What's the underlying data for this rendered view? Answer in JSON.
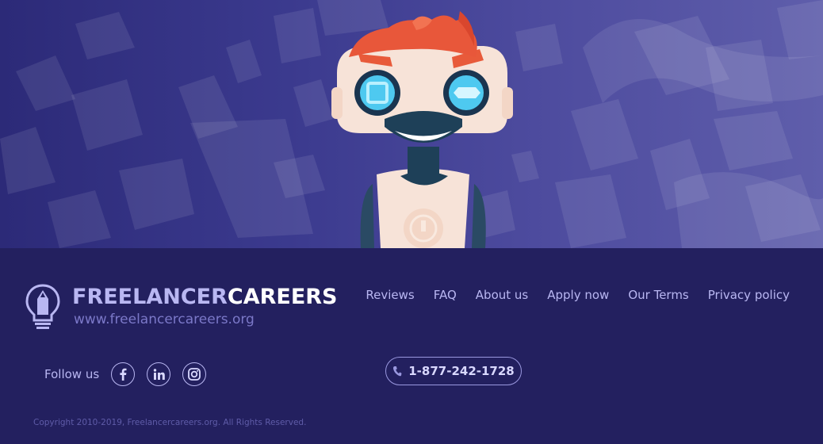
{
  "brand": {
    "name_part1": "FREELANCER",
    "name_part2": "CAREERS",
    "url": "www.freelancercareers.org",
    "logo_icon": "lightbulb-pencil-icon"
  },
  "nav": {
    "items": [
      {
        "label": "Reviews"
      },
      {
        "label": "FAQ"
      },
      {
        "label": "About us"
      },
      {
        "label": "Apply now"
      },
      {
        "label": "Our Terms"
      },
      {
        "label": "Privacy policy"
      }
    ]
  },
  "social": {
    "label": "Follow us",
    "icons": [
      "facebook-icon",
      "linkedin-icon",
      "instagram-icon"
    ]
  },
  "contact": {
    "phone": "1-877-242-1728",
    "icon": "phone-icon"
  },
  "copyright": "Copyright 2010-2019, Freelancercareers.org.  All Rights Reserved.",
  "hero": {
    "illustration": "robot-with-red-hair-mascot"
  },
  "colors": {
    "hero_gradient_start": "#2c2a78",
    "hero_gradient_end": "#5f5eab",
    "footer_bg": "#23205f",
    "text_light": "#b9b7f2",
    "brand_white": "#ffffff",
    "robot_hair": "#e8573a",
    "robot_eye": "#4ec9f0"
  }
}
